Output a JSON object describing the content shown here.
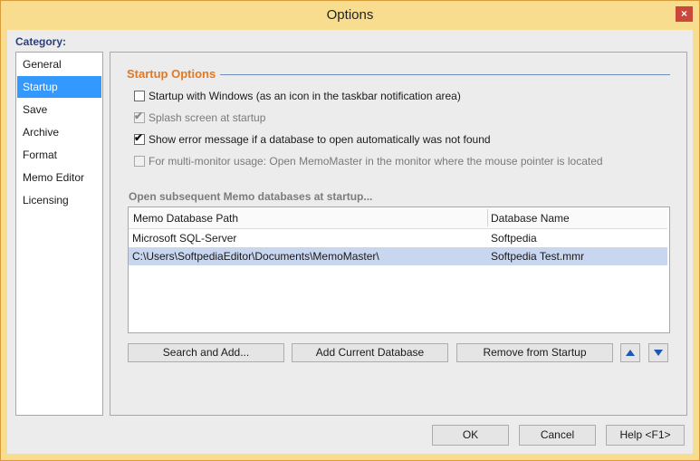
{
  "window": {
    "title": "Options",
    "close_glyph": "×"
  },
  "category": {
    "label": "Category:",
    "items": [
      "General",
      "Startup",
      "Save",
      "Archive",
      "Format",
      "Memo Editor",
      "Licensing"
    ],
    "selected": "Startup"
  },
  "startup": {
    "section_title": "Startup Options",
    "options": [
      {
        "label": "Startup with Windows (as an icon in the taskbar notification area)",
        "checked": false,
        "enabled": true
      },
      {
        "label": "Splash screen at startup",
        "checked": true,
        "enabled": false
      },
      {
        "label": "Show error message if a database to open automatically was not found",
        "checked": true,
        "enabled": true
      },
      {
        "label": "For multi-monitor usage: Open MemoMaster in the monitor where the mouse pointer is located",
        "checked": false,
        "enabled": false
      }
    ],
    "databases_title": "Open subsequent Memo databases at startup...",
    "columns": [
      "Memo Database Path",
      "Database Name"
    ],
    "rows": [
      {
        "path": "Microsoft SQL-Server",
        "name": "Softpedia",
        "selected": false
      },
      {
        "path": "C:\\Users\\SoftpediaEditor\\Documents\\MemoMaster\\",
        "name": "Softpedia Test.mmr",
        "selected": true
      }
    ],
    "buttons": {
      "search_add": "Search and Add...",
      "add_current": "Add Current Database",
      "remove": "Remove from Startup"
    }
  },
  "footer": {
    "ok": "OK",
    "cancel": "Cancel",
    "help": "Help <F1>"
  },
  "icons": {
    "move_up": "arrow-up-icon",
    "move_down": "arrow-down-icon",
    "check": "checkmark-icon"
  },
  "colors": {
    "selection": "#3399ff",
    "section_title": "#e27820",
    "category_label": "#2c3f78",
    "row_selection": "#c8d6ef"
  }
}
